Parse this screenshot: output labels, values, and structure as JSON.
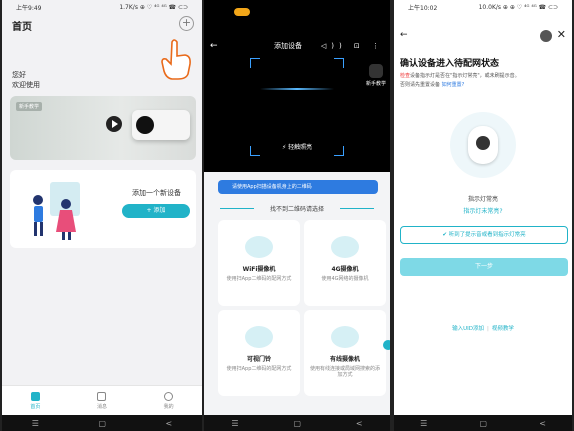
{
  "screen1": {
    "status_time": "上午9:49",
    "status_right": "1.7K/s ⊕ ♡ ⁴ᴳ ⁴ᴳ ☎ ⊂⊃",
    "title": "首页",
    "plus_icon": "+",
    "greeting": "您好",
    "welcome": "欢迎使用",
    "banner_tag": "新手教学",
    "add_device_text": "添加一个新设备",
    "add_button": "+ 添加",
    "tabs": [
      {
        "label": "首页",
        "icon": "home-icon"
      },
      {
        "label": "消息",
        "icon": "message-icon"
      },
      {
        "label": "我的",
        "icon": "profile-icon"
      }
    ],
    "accent": "#21b3c8"
  },
  "screen2": {
    "title": "添加设备",
    "header_icons": "◁)) ⊡ ⋮",
    "torch": "⚡ 轻触照亮",
    "novice": "新手教学",
    "hint": "请使用App扫描设备机身上的二维码",
    "sub": "找不到二维码请选择",
    "devices": [
      {
        "name": "WiFi摄像机",
        "desc": "使用扫App二维码的配网方式"
      },
      {
        "name": "4G摄像机",
        "desc": "使用4G网络的摄像机"
      },
      {
        "name": "可视门铃",
        "desc": "使用扫App二维码的配网方式"
      },
      {
        "name": "有线摄像机",
        "desc": "使用有线连接或局域网搜索的添加方式"
      }
    ]
  },
  "screen3": {
    "status_time": "上午10:02",
    "status_right": "10.0K/s ⊕ ⊕ ♡ ⁴ᴳ ⁴ᴳ ☎ ⊂⊃",
    "title": "确认设备进入待配网状态",
    "desc_red": "检查",
    "desc_main": "设备指示灯是否在\"指示灯常亮\"，或未刷提示音。",
    "desc_line2": "否则请先重置设备",
    "desc_link": "如何重置?",
    "led_label": "指示灯常亮",
    "led_link": "指示灯未常亮?",
    "confirm": "听到了提示音或看到指示灯常亮",
    "next": "下一步",
    "link_uid": "输入UID添加",
    "link_video": "视频教学"
  }
}
